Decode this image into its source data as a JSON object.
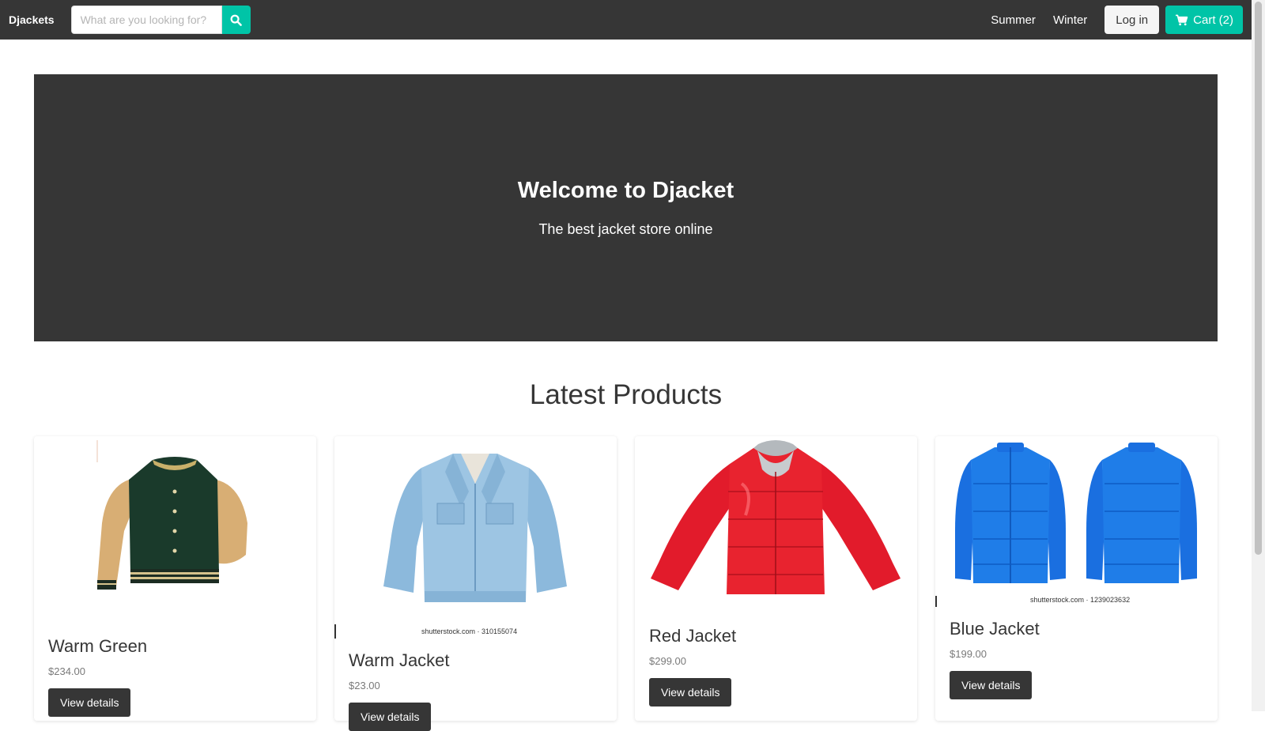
{
  "navbar": {
    "brand": "Djackets",
    "search_placeholder": "What are you looking for?",
    "links": [
      "Summer",
      "Winter"
    ],
    "login_label": "Log in",
    "cart_label": "Cart (2)"
  },
  "hero": {
    "title": "Welcome to Djacket",
    "subtitle": "The best jacket store online"
  },
  "section": {
    "title": "Latest Products"
  },
  "products": [
    {
      "name": "Warm Green",
      "price": "$234.00",
      "button": "View details",
      "image": "green-varsity-jacket-image"
    },
    {
      "name": "Warm Jacket",
      "price": "$23.00",
      "button": "View details",
      "image": "denim-jacket-image",
      "watermark": "shutterstock.com · 310155074"
    },
    {
      "name": "Red Jacket",
      "price": "$299.00",
      "button": "View details",
      "image": "red-puffer-jacket-image"
    },
    {
      "name": "Blue Jacket",
      "price": "$199.00",
      "button": "View details",
      "image": "blue-puffer-jacket-image",
      "watermark": "shutterstock.com · 1239023632"
    }
  ],
  "colors": {
    "dark": "#363636",
    "accent": "#00c4a7",
    "light": "#f5f5f5"
  }
}
